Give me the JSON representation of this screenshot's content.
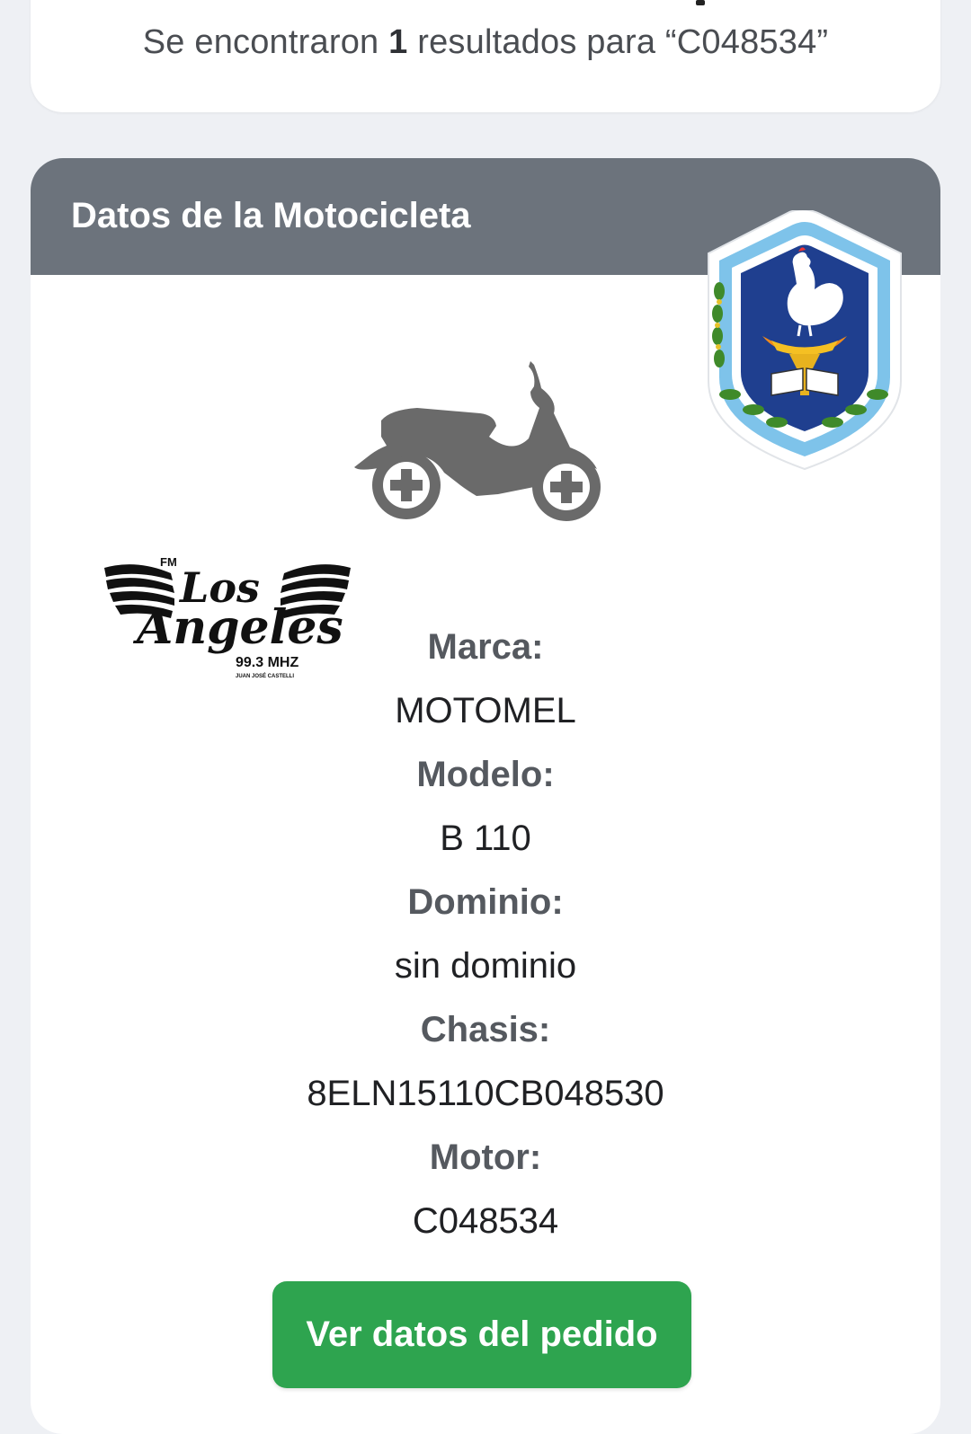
{
  "search": {
    "summary_prefix": "Se encontraron ",
    "count": "1",
    "summary_middle": " resultados para ",
    "query": "“C048534”"
  },
  "card": {
    "title": "Datos de la Motocicleta"
  },
  "radio_logo": {
    "fm": "FM",
    "name_line1": "Los",
    "name_line2": "Angeles",
    "frequency": "99.3 MHZ",
    "town": "JUAN JOSÉ CASTELLI"
  },
  "fields": [
    {
      "label": "Marca:",
      "value": "MOTOMEL"
    },
    {
      "label": "Modelo:",
      "value": "B 110"
    },
    {
      "label": "Dominio:",
      "value": "sin dominio"
    },
    {
      "label": "Chasis:",
      "value": "8ELN15110CB048530"
    },
    {
      "label": "Motor:",
      "value": "C048534"
    }
  ],
  "actions": {
    "view_order_label": "Ver datos del pedido"
  },
  "colors": {
    "header_bg": "#6c737c",
    "button_bg": "#2ea44f",
    "page_bg": "#eef0f4"
  },
  "icons": {
    "motorcycle": "motorcycle-icon",
    "crest": "police-crest-logo",
    "radio": "radio-station-logo"
  }
}
